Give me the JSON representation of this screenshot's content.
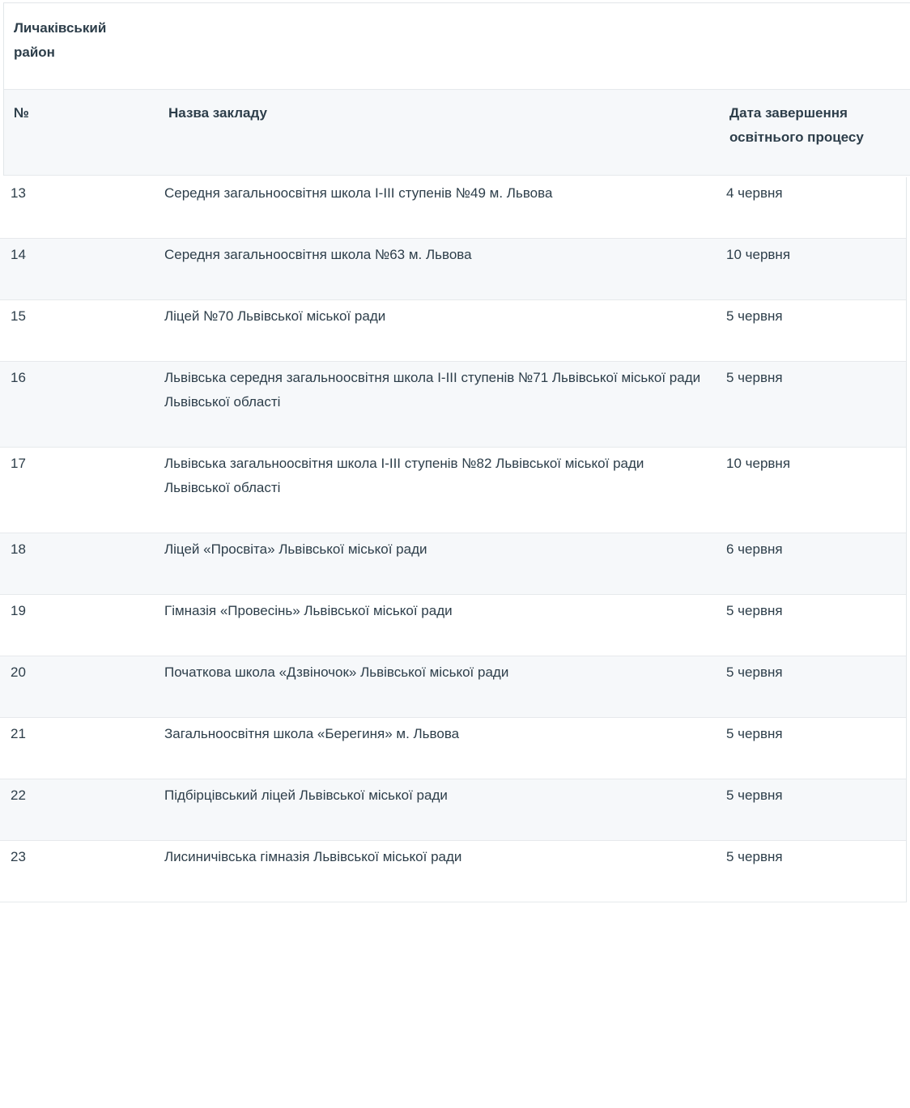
{
  "district": {
    "name": "Личаківський район"
  },
  "columns": {
    "number": "№",
    "name": "Назва закладу",
    "date": "Дата завершення освітнього процесу"
  },
  "rows": [
    {
      "number": "13",
      "name": "Середня загальноосвітня школа І-ІІІ ступенів №49 м. Львова",
      "date": "4 червня"
    },
    {
      "number": "14",
      "name": "Середня загальноосвітня школа №63 м. Львова",
      "date": "10 червня"
    },
    {
      "number": "15",
      "name": "Ліцей №70 Львівської міської ради",
      "date": "5 червня"
    },
    {
      "number": "16",
      "name": "Львівська середня загальноосвітня школа І-ІІІ ступенів №71 Львівської міської ради Львівської області",
      "date": "5 червня"
    },
    {
      "number": "17",
      "name": "Львівська загальноосвітня школа І-ІІІ ступенів №82 Львівської міської ради Львівської області",
      "date": "10 червня"
    },
    {
      "number": "18",
      "name": "Ліцей «Просвіта» Львівської міської ради",
      "date": "6 червня"
    },
    {
      "number": "19",
      "name": "Гімназія «Провесінь» Львівської міської ради",
      "date": "5 червня"
    },
    {
      "number": "20",
      "name": "Початкова школа «Дзвіночок» Львівської міської ради",
      "date": "5 червня"
    },
    {
      "number": "21",
      "name": "Загальноосвітня школа «Берегиня» м. Львова",
      "date": "5 червня"
    },
    {
      "number": "22",
      "name": "Підбірцівський ліцей Львівської міської ради",
      "date": "5 червня"
    },
    {
      "number": "23",
      "name": "Лисиничівська гімназія Львівської міської ради",
      "date": "5 червня"
    }
  ]
}
